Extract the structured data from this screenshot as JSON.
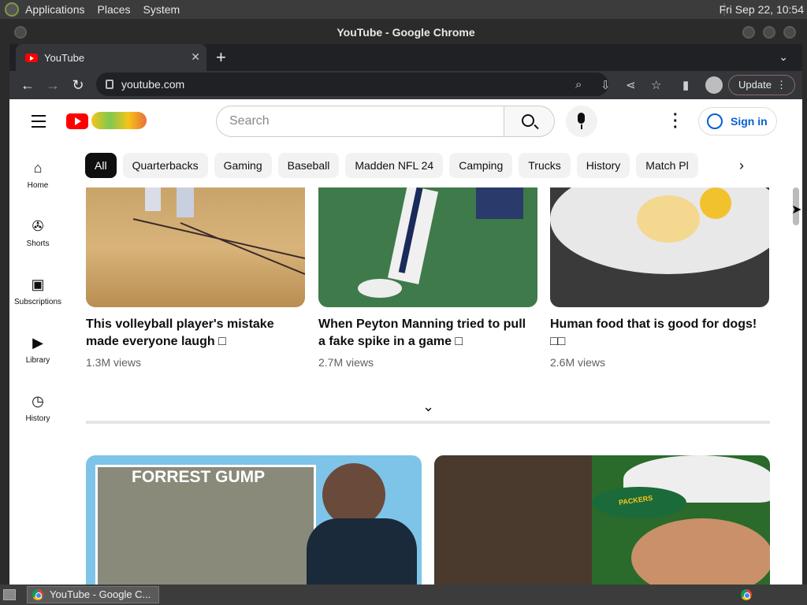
{
  "os": {
    "menus": [
      "Applications",
      "Places",
      "System"
    ],
    "clock": "Fri Sep 22, 10:54"
  },
  "window": {
    "title": "YouTube - Google Chrome",
    "tab_label": "YouTube",
    "url": "youtube.com",
    "update_label": "Update"
  },
  "youtube": {
    "search_placeholder": "Search",
    "signin_label": "Sign in",
    "guide": [
      {
        "label": "Home",
        "icon": "home-icon"
      },
      {
        "label": "Shorts",
        "icon": "shorts-icon"
      },
      {
        "label": "Subscriptions",
        "icon": "subscriptions-icon"
      },
      {
        "label": "Library",
        "icon": "library-icon"
      },
      {
        "label": "History",
        "icon": "history-icon"
      }
    ],
    "chips": [
      "All",
      "Quarterbacks",
      "Gaming",
      "Baseball",
      "Madden NFL 24",
      "Camping",
      "Trucks",
      "History",
      "Match Pl"
    ],
    "shorts": [
      {
        "title_line1": "This volleyball player's mistake",
        "title_line2": "made everyone laugh □",
        "views": "1.3M views"
      },
      {
        "title_line1": "When Peyton Manning tried to pull",
        "title_line2": "a fake spike in a game □",
        "views": "2.7M views"
      },
      {
        "title_line1": "Human food that is good for dogs!",
        "title_line2": "□□",
        "views": "2.6M views"
      }
    ],
    "thumb_caption": "FORREST GUMP",
    "cap_logo": "PACKERS"
  },
  "taskbar": {
    "app_label": "YouTube - Google C..."
  }
}
